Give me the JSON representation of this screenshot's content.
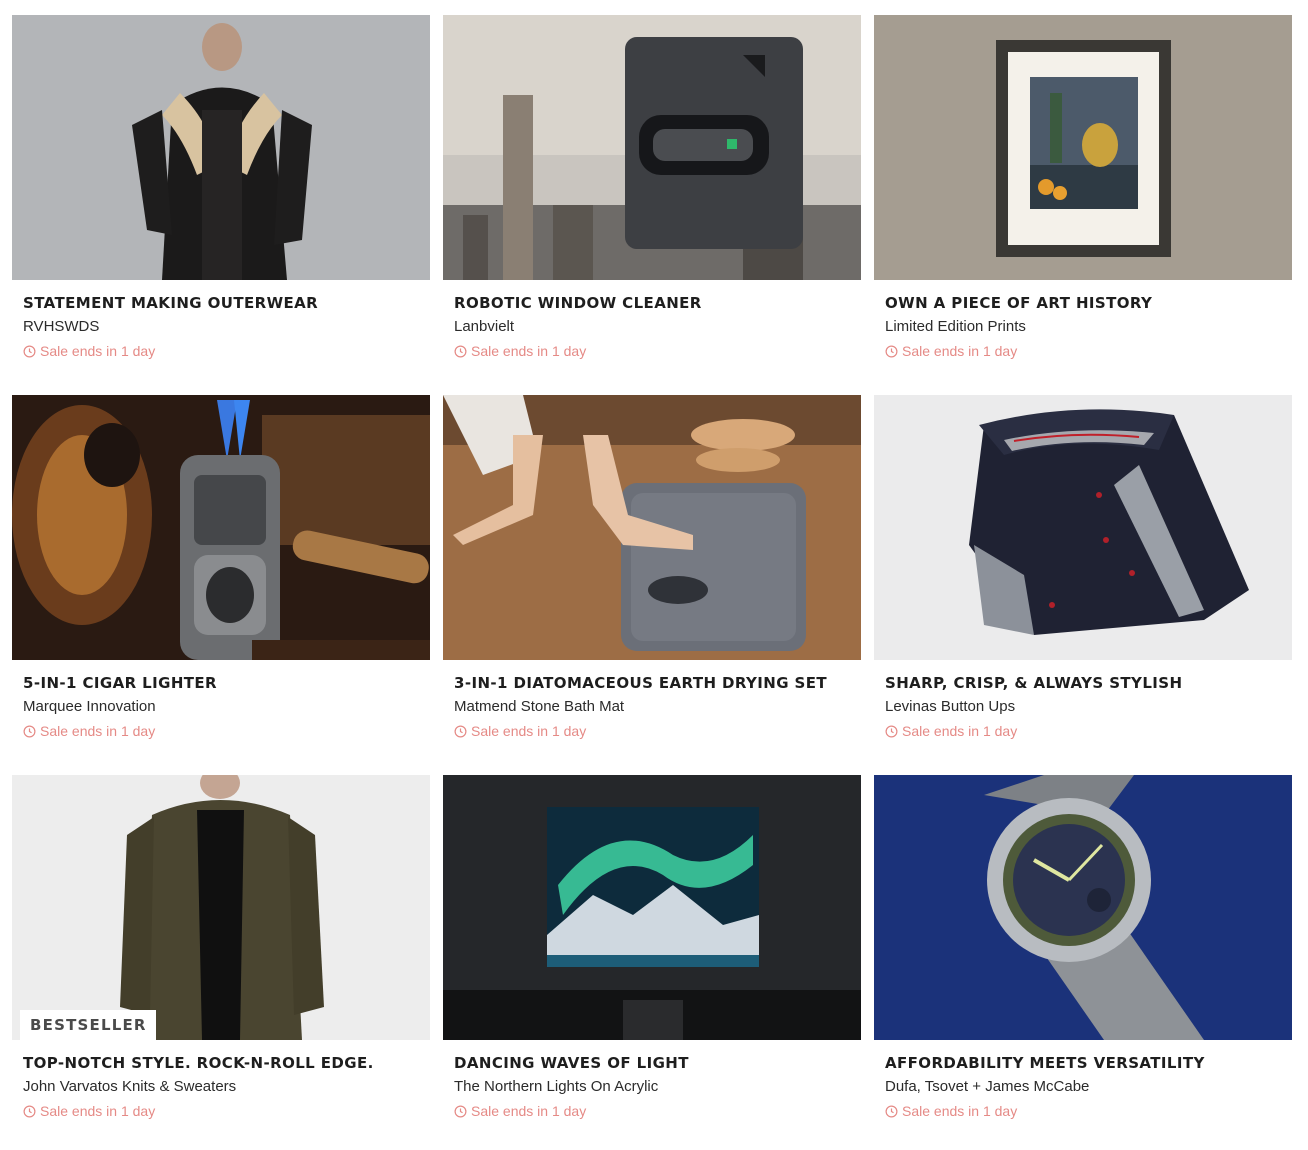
{
  "products": [
    {
      "title": "STATEMENT MAKING OUTERWEAR",
      "brand": "RVHSWDS",
      "sale": "Sale ends in 1 day",
      "badge": ""
    },
    {
      "title": "ROBOTIC WINDOW CLEANER",
      "brand": "Lanbvielt",
      "sale": "Sale ends in 1 day",
      "badge": ""
    },
    {
      "title": "OWN A PIECE OF ART HISTORY",
      "brand": "Limited Edition Prints",
      "sale": "Sale ends in 1 day",
      "badge": ""
    },
    {
      "title": "5-IN-1 CIGAR LIGHTER",
      "brand": "Marquee Innovation",
      "sale": "Sale ends in 1 day",
      "badge": ""
    },
    {
      "title": "3-IN-1 DIATOMACEOUS EARTH DRYING SET",
      "brand": "Matmend Stone Bath Mat",
      "sale": "Sale ends in 1 day",
      "badge": ""
    },
    {
      "title": "SHARP, CRISP, & ALWAYS STYLISH",
      "brand": "Levinas Button Ups",
      "sale": "Sale ends in 1 day",
      "badge": ""
    },
    {
      "title": "TOP-NOTCH STYLE. ROCK-N-ROLL EDGE.",
      "brand": "John Varvatos Knits & Sweaters",
      "sale": "Sale ends in 1 day",
      "badge": "BESTSELLER"
    },
    {
      "title": "DANCING WAVES OF LIGHT",
      "brand": "The Northern Lights On Acrylic",
      "sale": "Sale ends in 1 day",
      "badge": ""
    },
    {
      "title": "AFFORDABILITY MEETS VERSATILITY",
      "brand": "Dufa, Tsovet + James McCabe",
      "sale": "Sale ends in 1 day",
      "badge": ""
    }
  ],
  "colors": {
    "sale_text": "#e58a86",
    "title_text": "#1e1e1e"
  }
}
